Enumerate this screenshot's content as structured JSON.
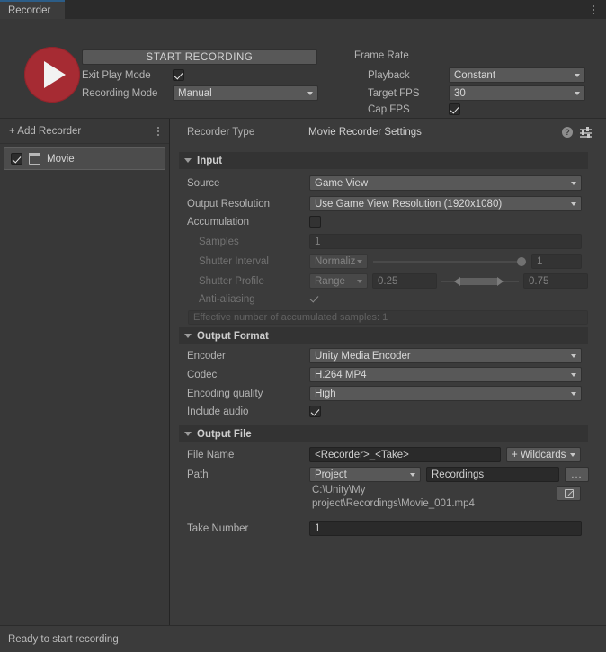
{
  "window": {
    "tab_label": "Recorder",
    "menu_icon": "kebab-menu-icon"
  },
  "controls": {
    "record_button_icon": "play-record-icon",
    "start_recording_label": "START RECORDING",
    "exit_play_mode_label": "Exit Play Mode",
    "exit_play_mode_checked": "✓",
    "recording_mode_label": "Recording Mode",
    "recording_mode_value": "Manual"
  },
  "frame_rate": {
    "title": "Frame Rate",
    "playback_label": "Playback",
    "playback_value": "Constant",
    "target_fps_label": "Target FPS",
    "target_fps_value": "30",
    "cap_fps_label": "Cap FPS",
    "cap_fps_checked": "✓"
  },
  "sidebar": {
    "add_recorder_label": "+ Add Recorder",
    "menu_icon": "kebab-menu-icon",
    "items": [
      {
        "label": "Movie",
        "enabled": true,
        "icon": "movie-icon"
      }
    ]
  },
  "panel": {
    "recorder_type_label": "Recorder Type",
    "recorder_type_value": "Movie Recorder Settings",
    "help_icon": "?",
    "preset_icon": "preset-sliders-icon"
  },
  "input_section": {
    "title": "Input",
    "source_label": "Source",
    "source_value": "Game View",
    "output_resolution_label": "Output Resolution",
    "output_resolution_value": "Use Game View Resolution (1920x1080)",
    "accumulation_label": "Accumulation",
    "accumulation_checked": false,
    "samples_label": "Samples",
    "samples_value": "1",
    "shutter_interval_label": "Shutter Interval",
    "shutter_interval_mode": "Normaliz",
    "shutter_interval_value": "1",
    "shutter_profile_label": "Shutter Profile",
    "shutter_profile_mode": "Range",
    "shutter_profile_min": "0.25",
    "shutter_profile_max": "0.75",
    "anti_aliasing_label": "Anti-aliasing",
    "anti_aliasing_checked": "✓",
    "effective_samples_text": "Effective number of accumulated samples: 1"
  },
  "output_format_section": {
    "title": "Output Format",
    "encoder_label": "Encoder",
    "encoder_value": "Unity Media Encoder",
    "codec_label": "Codec",
    "codec_value": "H.264 MP4",
    "encoding_quality_label": "Encoding quality",
    "encoding_quality_value": "High",
    "include_audio_label": "Include audio",
    "include_audio_checked": "✓"
  },
  "output_file_section": {
    "title": "Output File",
    "file_name_label": "File Name",
    "file_name_value": "<Recorder>_<Take>",
    "wildcards_label": "+ Wildcards",
    "path_label": "Path",
    "path_mode": "Project",
    "path_value": "Recordings",
    "browse_label": "...",
    "open_icon": "external-link-icon",
    "resolved_path_line1": "C:\\Unity\\My",
    "resolved_path_line2": "project\\Recordings\\Movie_001.mp4",
    "take_number_label": "Take Number",
    "take_number_value": "1"
  },
  "status": {
    "message": "Ready to start recording"
  },
  "colors": {
    "record_red": "#a62b33",
    "tab_accent": "#2c5d87",
    "window_bg": "#383838",
    "panel_bg": "#3b3b3b"
  }
}
